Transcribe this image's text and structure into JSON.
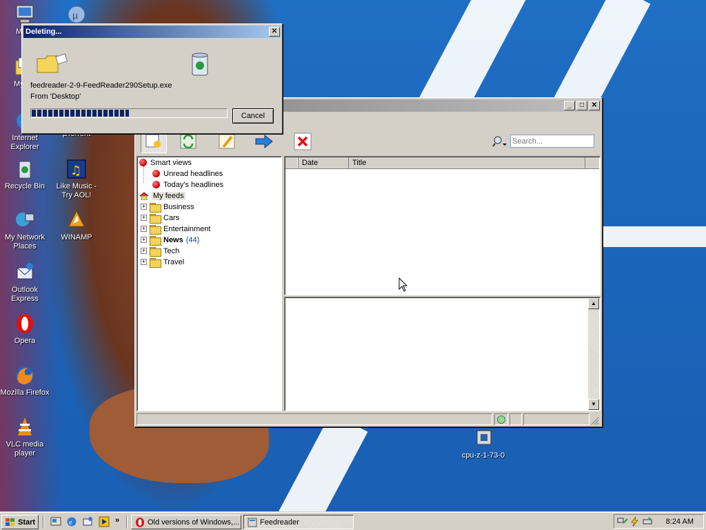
{
  "desktop": {
    "icons": [
      {
        "label": "My C",
        "icon": "my-computer-icon"
      },
      {
        "label": "My Do",
        "icon": "my-documents-icon"
      },
      {
        "label": "Internet Explorer",
        "icon": "internet-explorer-icon"
      },
      {
        "label": "Recycle Bin",
        "icon": "recycle-bin-icon"
      },
      {
        "label": "My Network Places",
        "icon": "network-places-icon"
      },
      {
        "label": "Outlook Express",
        "icon": "outlook-express-icon"
      },
      {
        "label": "Opera",
        "icon": "opera-icon"
      },
      {
        "label": "Mozilla Firefox",
        "icon": "firefox-icon"
      },
      {
        "label": "VLC media player",
        "icon": "vlc-icon"
      },
      {
        "label": "µTorrent",
        "icon": "utorrent-icon"
      },
      {
        "label": "Like Music - Try AOL!",
        "icon": "aol-music-icon"
      },
      {
        "label": "WINAMP",
        "icon": "winamp-icon"
      },
      {
        "label": "cpu-z-1-73-0",
        "icon": "cpu-z-icon"
      }
    ]
  },
  "delete_dialog": {
    "title": "Deleting...",
    "filename": "feedreader-2-9-FeedReader290Setup.exe",
    "source": "From 'Desktop'",
    "progress": 0.5,
    "cancel_label": "Cancel"
  },
  "feedreader": {
    "search_placeholder": "Search...",
    "columns": [
      "Date",
      "Title"
    ],
    "tree": {
      "smart_views": "Smart views",
      "unread": "Unread headlines",
      "today": "Today's headlines",
      "my_feeds": "My feeds",
      "folders": [
        {
          "label": "Business",
          "count": ""
        },
        {
          "label": "Cars",
          "count": ""
        },
        {
          "label": "Entertainment",
          "count": ""
        },
        {
          "label": "News",
          "count": "(44)"
        },
        {
          "label": "Tech",
          "count": ""
        },
        {
          "label": "Travel",
          "count": ""
        }
      ]
    }
  },
  "taskbar": {
    "start_label": "Start",
    "tasks": [
      "Old versions of Windows,...",
      "Feedreader"
    ],
    "clock": "8:24 AM"
  },
  "colors": {
    "title_active": "#0a246a",
    "title_inactive": "#808080",
    "desktop_blue": "#1f6fc4",
    "progress_blue": "#0a246a"
  }
}
